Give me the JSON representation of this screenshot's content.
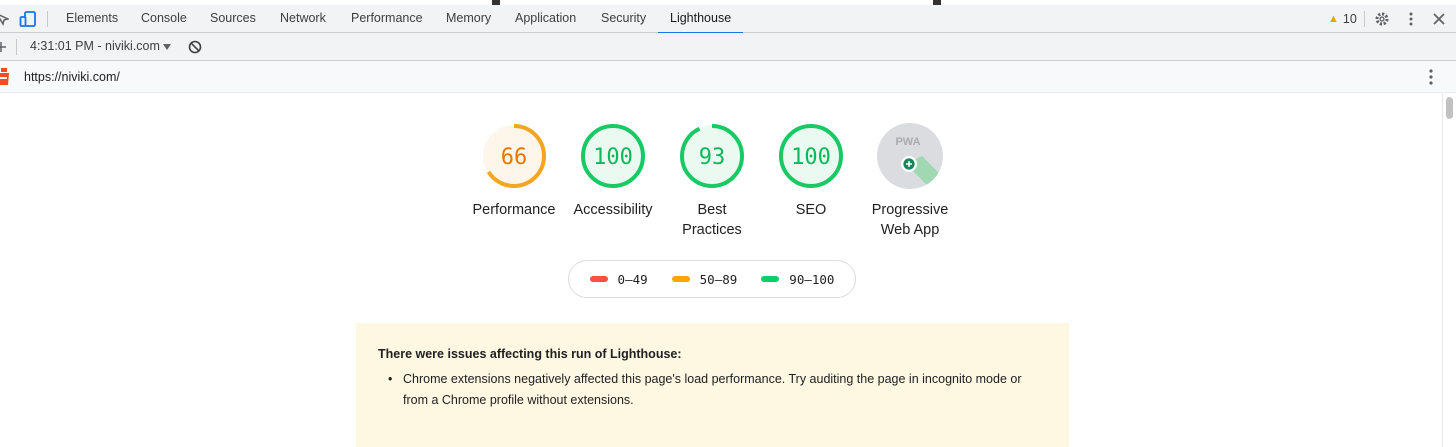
{
  "devtools": {
    "tabs": [
      {
        "label": "Elements"
      },
      {
        "label": "Console"
      },
      {
        "label": "Sources"
      },
      {
        "label": "Network"
      },
      {
        "label": "Performance"
      },
      {
        "label": "Memory"
      },
      {
        "label": "Application"
      },
      {
        "label": "Security"
      },
      {
        "label": "Lighthouse",
        "active": true
      }
    ],
    "warnings_count": "10",
    "accent_color": "#1a73e8"
  },
  "toolbar": {
    "report_selector": "4:31:01 PM - niviki.com"
  },
  "report": {
    "url": "https://niviki.com/",
    "gauges": [
      {
        "score": "66",
        "label_line1": "Performance",
        "label_line2": "",
        "fraction": 0.66,
        "status": "average",
        "color": "#f4a522"
      },
      {
        "score": "100",
        "label_line1": "Accessibility",
        "label_line2": "",
        "fraction": 1.0,
        "status": "pass",
        "color": "#18c964"
      },
      {
        "score": "93",
        "label_line1": "Best",
        "label_line2": "Practices",
        "fraction": 0.93,
        "status": "pass",
        "color": "#18c964"
      },
      {
        "score": "100",
        "label_line1": "SEO",
        "label_line2": "",
        "fraction": 1.0,
        "status": "pass",
        "color": "#18c964"
      },
      {
        "score": "PWA",
        "label_line1": "Progressive",
        "label_line2": "Web App",
        "fraction": null,
        "status": "pwa",
        "color": "#dadce0"
      }
    ],
    "legend": [
      {
        "range": "0–49",
        "color": "#ff4e42"
      },
      {
        "range": "50–89",
        "color": "#ffa400"
      },
      {
        "range": "90–100",
        "color": "#0cce6b"
      }
    ],
    "warning": {
      "title": "There were issues affecting this run of Lighthouse:",
      "items": [
        "Chrome extensions negatively affected this page's load performance. Try auditing the page in incognito mode or from a Chrome profile without extensions."
      ]
    }
  }
}
